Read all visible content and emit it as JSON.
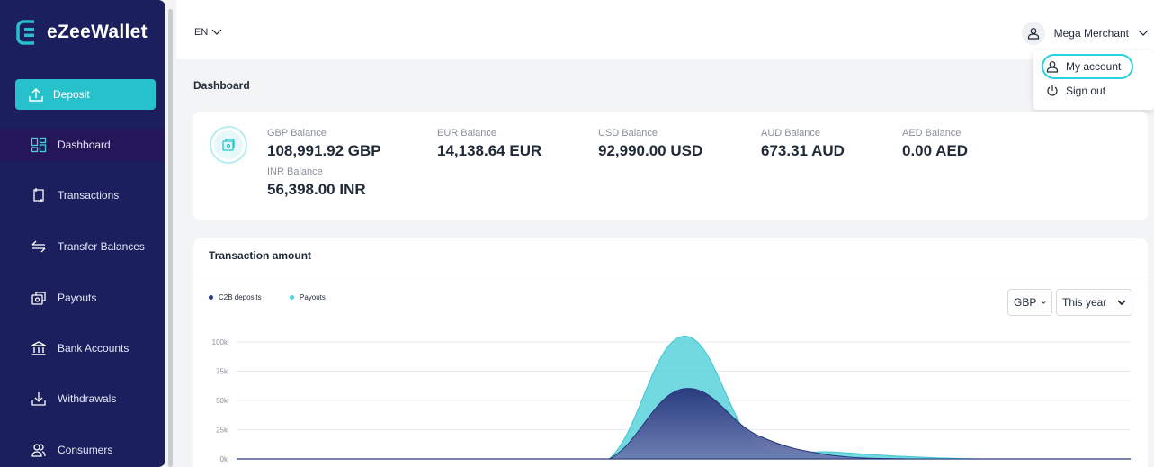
{
  "brand": {
    "name": "eZeeWallet"
  },
  "sidebar": {
    "deposit_label": "Deposit",
    "items": [
      {
        "label": "Dashboard",
        "icon": "dashboard-icon"
      },
      {
        "label": "Transactions",
        "icon": "transactions-icon"
      },
      {
        "label": "Transfer Balances",
        "icon": "transfer-icon"
      },
      {
        "label": "Payouts",
        "icon": "payouts-icon"
      },
      {
        "label": "Bank Accounts",
        "icon": "bank-icon"
      },
      {
        "label": "Withdrawals",
        "icon": "withdrawals-icon"
      },
      {
        "label": "Consumers",
        "icon": "consumers-icon"
      }
    ]
  },
  "topbar": {
    "language": "EN",
    "user_name": "Mega Merchant"
  },
  "user_menu": {
    "my_account": "My account",
    "sign_out": "Sign out"
  },
  "page": {
    "title": "Dashboard"
  },
  "balances": [
    {
      "label": "GBP Balance",
      "value": "108,991.92 GBP"
    },
    {
      "label": "EUR Balance",
      "value": "14,138.64 EUR"
    },
    {
      "label": "USD Balance",
      "value": "92,990.00 USD"
    },
    {
      "label": "AUD Balance",
      "value": "673.31 AUD"
    },
    {
      "label": "AED Balance",
      "value": "0.00 AED"
    },
    {
      "label": "INR Balance",
      "value": "56,398.00 INR"
    }
  ],
  "chart_card": {
    "title": "Transaction amount",
    "currency_select": "GBP",
    "period_select": "This year"
  },
  "colors": {
    "sidebar": "#1b1f5e",
    "accent": "#27c1cc",
    "c2b": "#2a3b7e",
    "payouts": "#4fcfd9"
  },
  "chart_data": {
    "type": "area",
    "y_ticks": [
      "100k",
      "75k",
      "50k",
      "25k",
      "0k"
    ],
    "ylim": [
      0,
      100000
    ],
    "x": [
      0,
      1,
      2,
      3,
      4,
      5,
      6,
      7,
      8,
      9,
      10,
      11,
      12
    ],
    "series": [
      {
        "name": "C2B deposits",
        "values": [
          0,
          0,
          0,
          0,
          0,
          0,
          60000,
          20000,
          3000,
          0,
          0,
          0,
          0
        ]
      },
      {
        "name": "Payouts",
        "values": [
          0,
          0,
          0,
          0,
          0,
          0,
          105000,
          10000,
          6000,
          2000,
          0,
          0,
          0
        ]
      }
    ]
  }
}
